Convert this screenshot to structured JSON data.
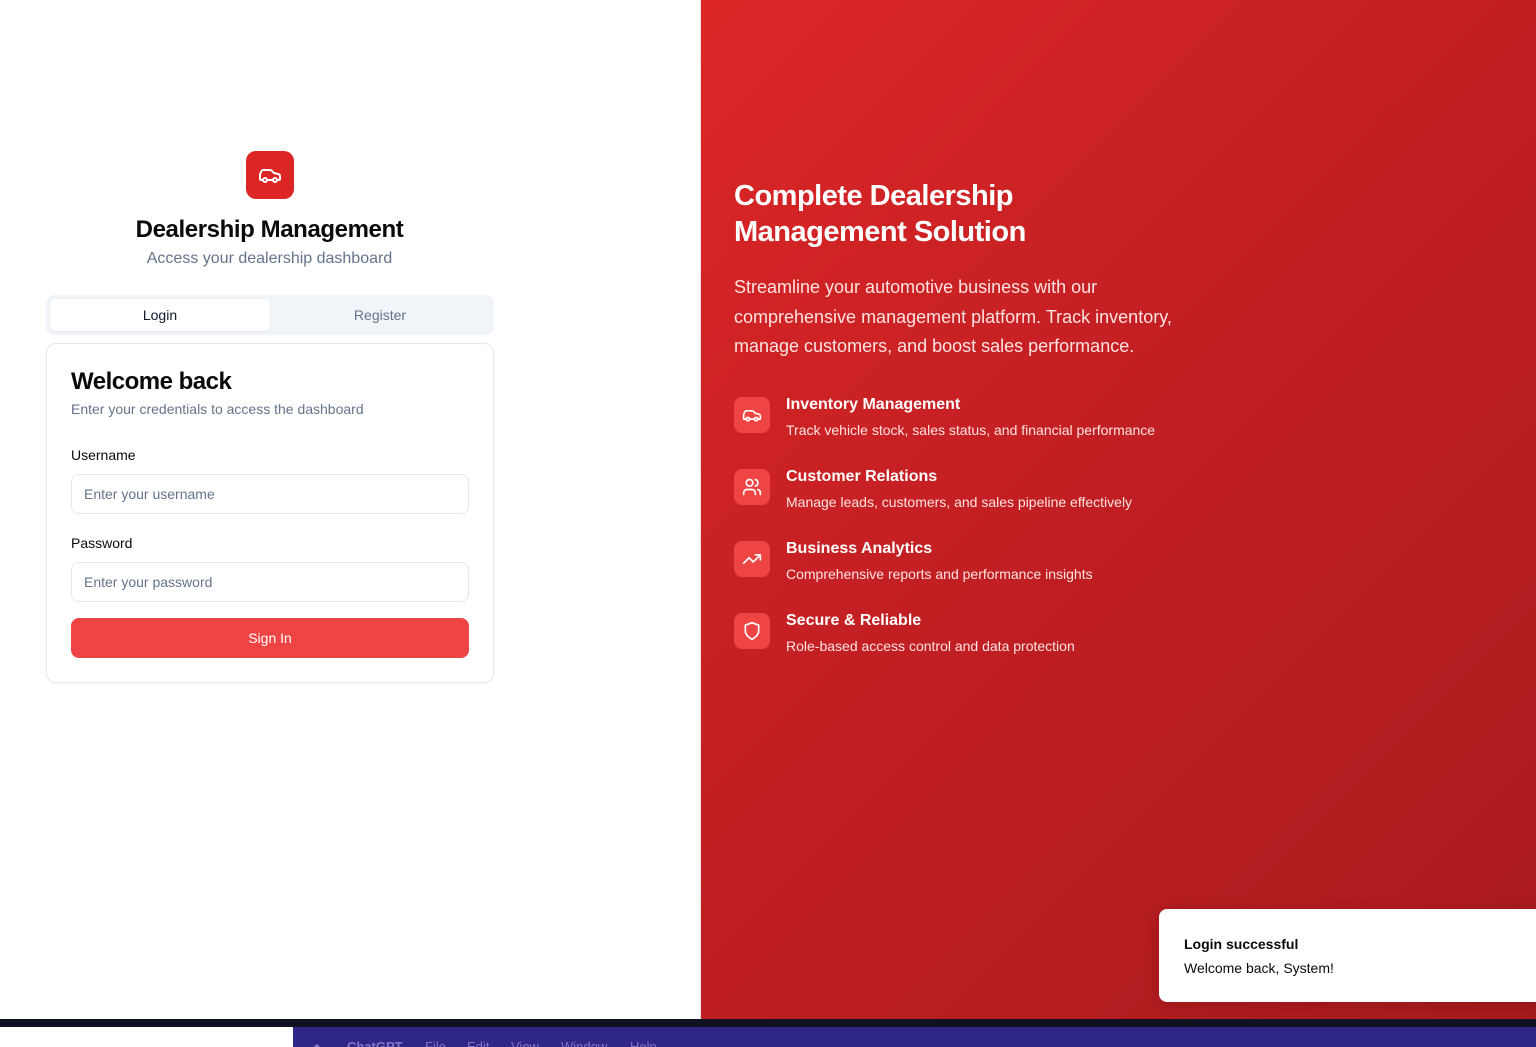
{
  "brand": {
    "title": "Dealership Management",
    "subtitle": "Access your dealership dashboard",
    "logo_icon": "car-icon",
    "accent_color": "#dc2626"
  },
  "tabs": [
    {
      "label": "Login",
      "active": true
    },
    {
      "label": "Register",
      "active": false
    }
  ],
  "login_card": {
    "title": "Welcome back",
    "description": "Enter your credentials to access the dashboard",
    "username_label": "Username",
    "username_placeholder": "Enter your username",
    "username_value": "",
    "password_label": "Password",
    "password_placeholder": "Enter your password",
    "password_value": "",
    "submit_label": "Sign In"
  },
  "hero": {
    "title": "Complete Dealership Management Solution",
    "description": "Streamline your automotive business with our comprehensive management platform. Track inventory, manage customers, and boost sales performance.",
    "features": [
      {
        "icon": "car-icon",
        "title": "Inventory Management",
        "description": "Track vehicle stock, sales status, and financial performance"
      },
      {
        "icon": "users-icon",
        "title": "Customer Relations",
        "description": "Manage leads, customers, and sales pipeline effectively"
      },
      {
        "icon": "trending-up-icon",
        "title": "Business Analytics",
        "description": "Comprehensive reports and performance insights"
      },
      {
        "icon": "shield-icon",
        "title": "Secure & Reliable",
        "description": "Role-based access control and data protection"
      }
    ]
  },
  "toast": {
    "title": "Login successful",
    "description": "Welcome back, System!"
  },
  "menubar": {
    "app": "ChatGPT",
    "items": [
      "File",
      "Edit",
      "View",
      "Window",
      "Help"
    ]
  }
}
